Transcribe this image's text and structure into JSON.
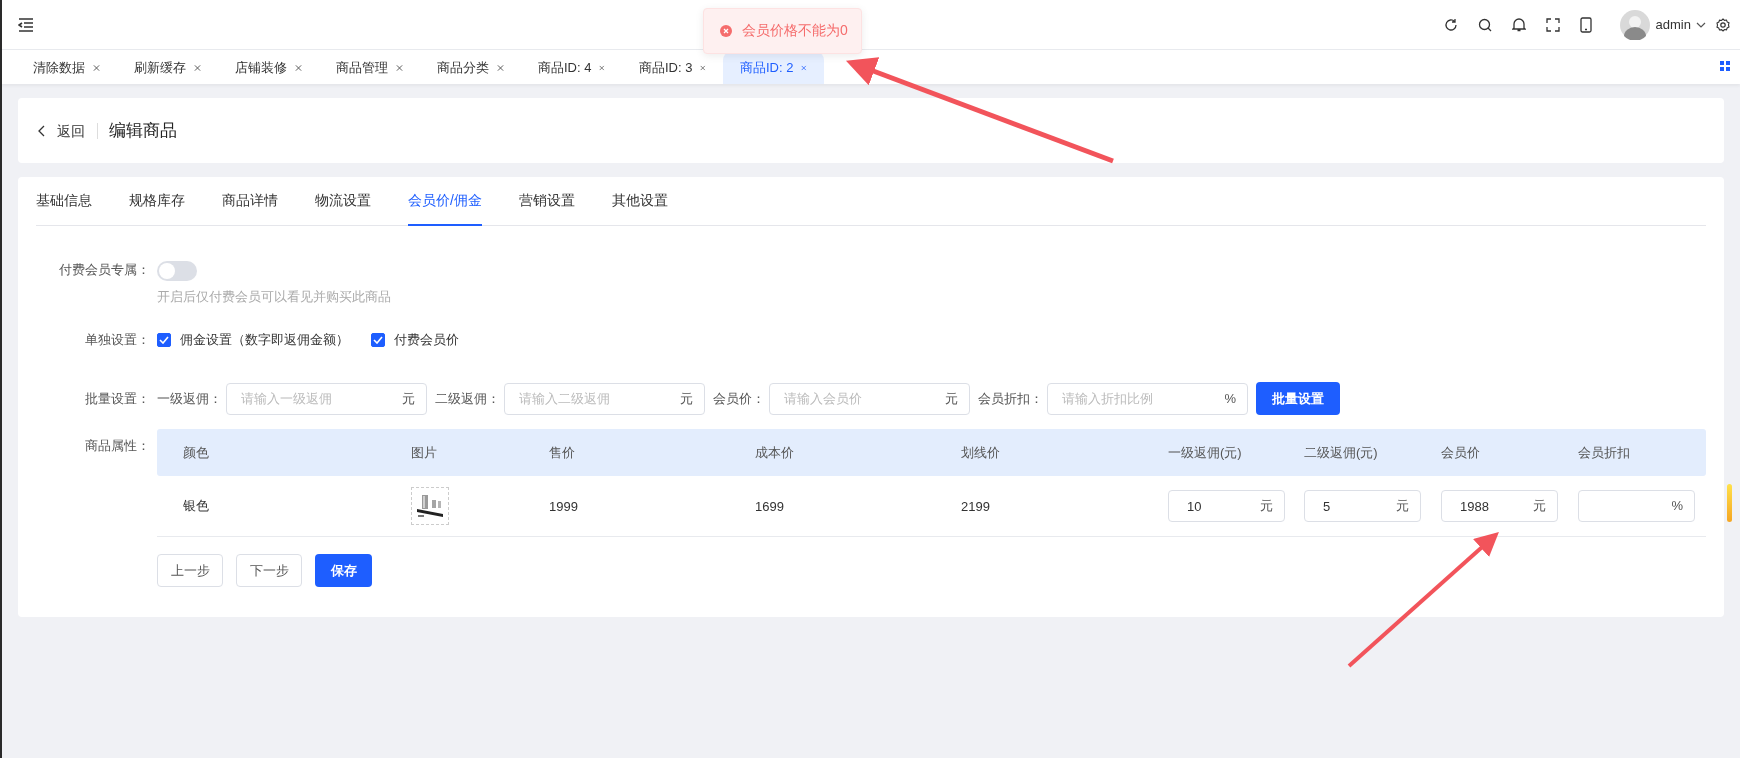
{
  "topbar": {
    "user": "admin"
  },
  "toast": {
    "message": "会员价格不能为0"
  },
  "page_tabs": [
    {
      "label": "清除数据",
      "selected": false
    },
    {
      "label": "刷新缓存",
      "selected": false
    },
    {
      "label": "店铺装修",
      "selected": false
    },
    {
      "label": "商品管理",
      "selected": false
    },
    {
      "label": "商品分类",
      "selected": false
    },
    {
      "label": "商品ID: 4",
      "selected": false
    },
    {
      "label": "商品ID: 3",
      "selected": false
    },
    {
      "label": "商品ID: 2",
      "selected": true
    }
  ],
  "header": {
    "back": "返回",
    "title": "编辑商品"
  },
  "form_tabs": [
    {
      "label": "基础信息",
      "selected": false
    },
    {
      "label": "规格库存",
      "selected": false
    },
    {
      "label": "商品详情",
      "selected": false
    },
    {
      "label": "物流设置",
      "selected": false
    },
    {
      "label": "会员价/佣金",
      "selected": true
    },
    {
      "label": "营销设置",
      "selected": false
    },
    {
      "label": "其他设置",
      "selected": false
    }
  ],
  "exclusive": {
    "label": "付费会员专属：",
    "on": false,
    "hint": "开启后仅付费会员可以看见并购买此商品"
  },
  "individual": {
    "label": "单独设置：",
    "options": [
      {
        "label": "佣金设置（数字即返佣金额）",
        "checked": true
      },
      {
        "label": "付费会员价",
        "checked": true
      }
    ]
  },
  "batch": {
    "label": "批量设置：",
    "fields": [
      {
        "label": "一级返佣：",
        "placeholder": "请输入一级返佣",
        "unit": "元"
      },
      {
        "label": "二级返佣：",
        "placeholder": "请输入二级返佣",
        "unit": "元"
      },
      {
        "label": "会员价：",
        "placeholder": "请输入会员价",
        "unit": "元"
      },
      {
        "label": "会员折扣：",
        "placeholder": "请输入折扣比例",
        "unit": "%"
      }
    ],
    "button": "批量设置"
  },
  "attributes": {
    "label": "商品属性：",
    "columns": [
      "颜色",
      "图片",
      "售价",
      "成本价",
      "划线价",
      "一级返佣(元)",
      "二级返佣(元)",
      "会员价",
      "会员折扣"
    ],
    "rows": [
      {
        "cells": [
          {
            "kind": "text",
            "value": "银色"
          },
          {
            "kind": "picture"
          },
          {
            "kind": "text",
            "value": "1999"
          },
          {
            "kind": "text",
            "value": "1699"
          },
          {
            "kind": "text",
            "value": "2199"
          },
          {
            "kind": "input",
            "value": "10",
            "unit": "元"
          },
          {
            "kind": "input",
            "value": "5",
            "unit": "元"
          },
          {
            "kind": "input",
            "value": "1988",
            "unit": "元"
          },
          {
            "kind": "input",
            "unit": "%"
          }
        ]
      }
    ]
  },
  "buttons": [
    {
      "label": "上一步",
      "kind": "default"
    },
    {
      "label": "下一步",
      "kind": "default"
    },
    {
      "label": "保存",
      "kind": "primary"
    }
  ]
}
